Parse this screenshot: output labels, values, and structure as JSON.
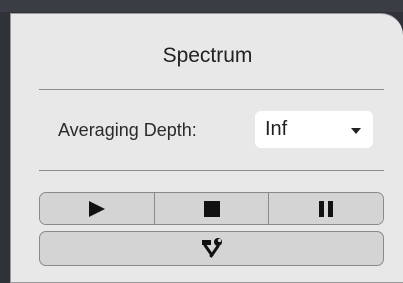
{
  "panel": {
    "title": "Spectrum",
    "averaging_label": "Averaging Depth:",
    "averaging_value": "Inf"
  },
  "icons": {
    "play": "play-icon",
    "stop": "stop-icon",
    "pause": "pause-icon",
    "tools": "tools-icon",
    "dropdown": "chevron-down-icon"
  }
}
